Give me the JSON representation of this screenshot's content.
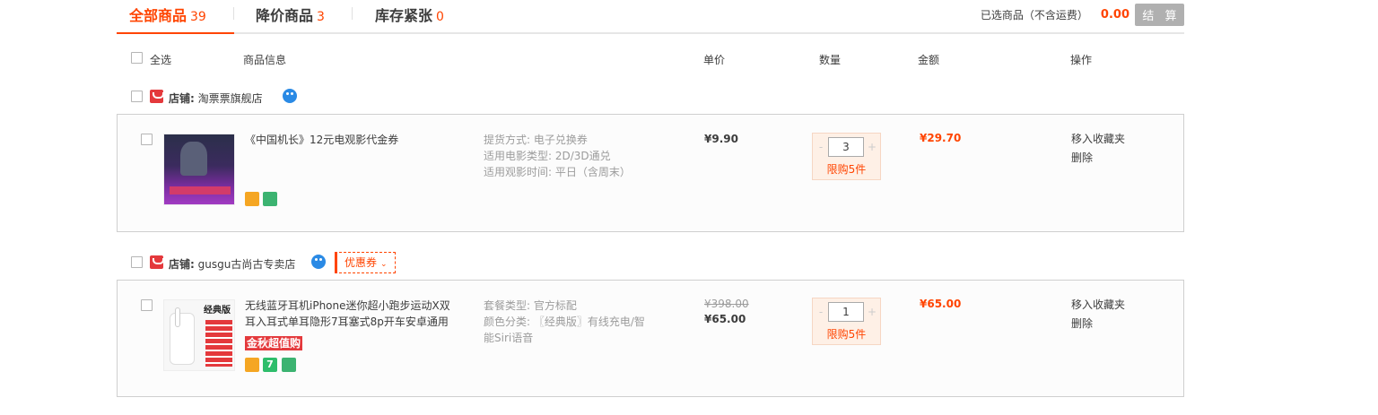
{
  "tabs": [
    {
      "label": "全部商品",
      "count": "39"
    },
    {
      "label": "降价商品",
      "count": "3"
    },
    {
      "label": "库存紧张",
      "count": "0"
    }
  ],
  "summary": {
    "label": "已选商品（不含运费）",
    "amount": "0.00",
    "settle_label": "结 算"
  },
  "header": {
    "select_all": "全选",
    "product_info": "商品信息",
    "unit_price": "单价",
    "quantity": "数量",
    "amount": "金额",
    "actions": "操作"
  },
  "shops": [
    {
      "prefix": "店铺:",
      "name": "淘票票旗舰店",
      "items": [
        {
          "title": "《中国机长》12元电观影代金券",
          "props": [
            "提货方式: 电子兑换券",
            "适用电影类型: 2D/3D通兑",
            "适用观影时间: 平日（含周末）"
          ],
          "price": "¥9.90",
          "quantity": "3",
          "limit": "限购5件",
          "total": "¥29.70",
          "actions": [
            "移入收藏夹",
            "删除"
          ]
        }
      ]
    },
    {
      "prefix": "店铺:",
      "name": "gusgu古尚古专卖店",
      "coupon": "优惠券",
      "items": [
        {
          "title": "无线蓝牙耳机iPhone迷你超小跑步运动X双耳入耳式单耳隐形7耳塞式8p开车安卓通用",
          "tag": "金秋超值购",
          "thumb_label": "经典版",
          "props": [
            "套餐类型: 官方标配",
            "颜色分类: 〖经典版〗有线充电/智能Siri语音"
          ],
          "price_old": "¥398.00",
          "price": "¥65.00",
          "quantity": "1",
          "limit": "限购5件",
          "total": "¥65.00",
          "actions": [
            "移入收藏夹",
            "删除"
          ]
        }
      ]
    }
  ],
  "colors": {
    "accent": "#ff4400",
    "settle_disabled": "#b0b0b0",
    "shop_icon": "#e4393c"
  }
}
